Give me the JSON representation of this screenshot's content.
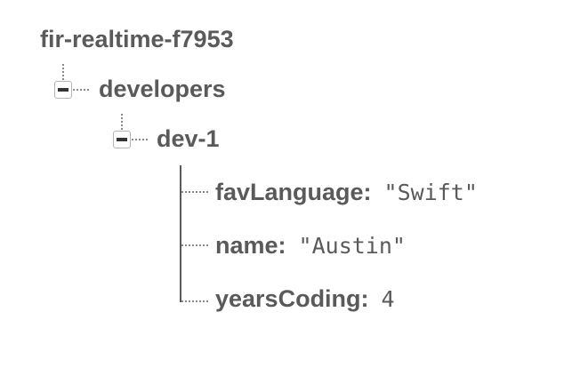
{
  "tree": {
    "root": {
      "name": "fir-realtime-f7953"
    },
    "developers": {
      "name": "developers",
      "toggle_icon": "collapse-minus-icon"
    },
    "dev1": {
      "name": "dev-1",
      "toggle_icon": "collapse-minus-icon"
    },
    "leaves": [
      {
        "key": "favLanguage",
        "colon": ":",
        "value": "\"Swift\""
      },
      {
        "key": "name",
        "colon": ":",
        "value": "\"Austin\""
      },
      {
        "key": "yearsCoding",
        "colon": ":",
        "value": "4"
      }
    ]
  }
}
